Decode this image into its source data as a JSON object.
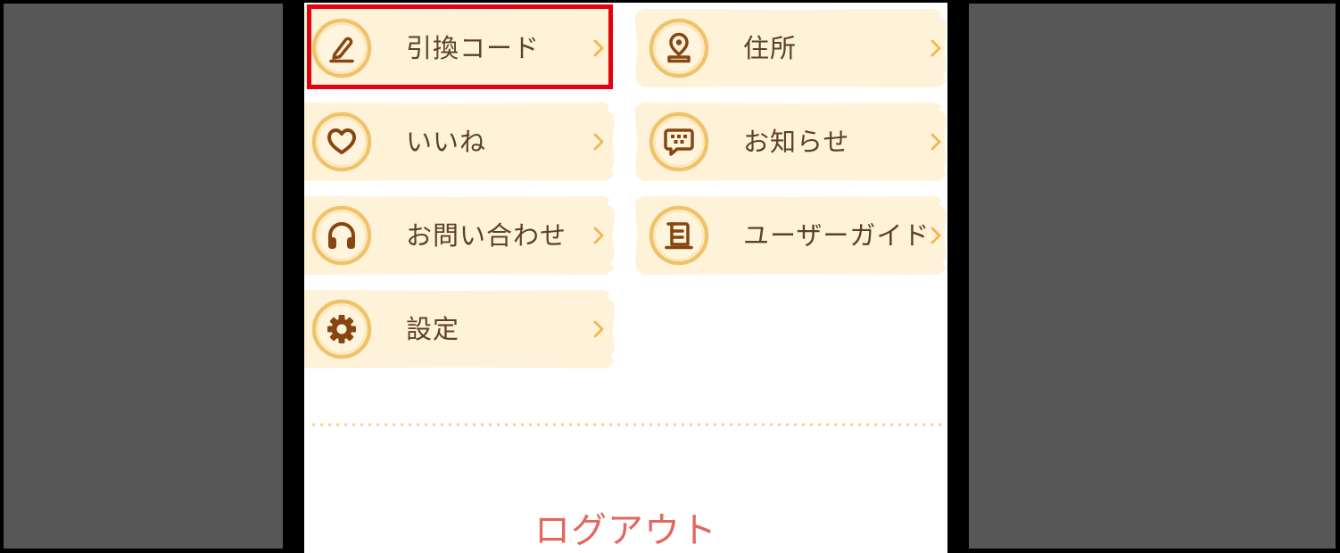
{
  "menu": {
    "left": [
      {
        "label": "引換コード",
        "icon": "pencil-icon",
        "highlighted": true
      },
      {
        "label": "いいね",
        "icon": "heart-icon"
      },
      {
        "label": "お問い合わせ",
        "icon": "headphones-icon"
      },
      {
        "label": "設定",
        "icon": "gear-icon"
      }
    ],
    "right": [
      {
        "label": "住所",
        "icon": "location-pin-icon"
      },
      {
        "label": "お知らせ",
        "icon": "chat-bubble-icon"
      },
      {
        "label": "ユーザーガイド",
        "icon": "guide-book-icon"
      }
    ],
    "chevron_icon": "chevron-right-icon"
  },
  "logout": {
    "label": "ログアウト"
  },
  "colors": {
    "background": "#000000",
    "side_panel": "#575757",
    "content_bg": "#ffffff",
    "tile_bg": "#fef2d9",
    "label_text": "#5c4128",
    "chevron": "#f2b648",
    "icon_brown": "#87460f",
    "icon_ring": "#f0c36a",
    "icon_fill": "#fff5df",
    "divider_dots": "#f3d27a",
    "highlight": "#e3000f",
    "logout_text": "#e2675c"
  }
}
